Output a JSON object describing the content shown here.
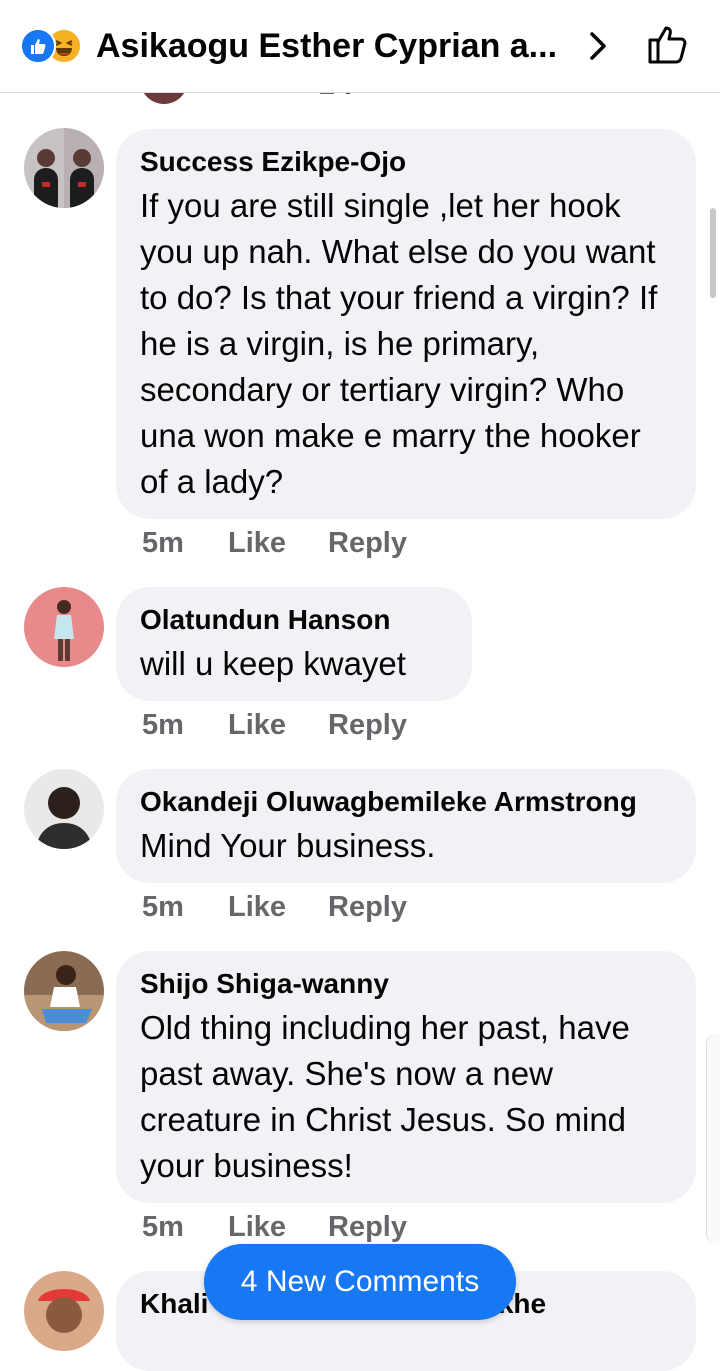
{
  "header": {
    "title": "Asikaogu Esther Cyprian a...",
    "reaction_icons": [
      "like-reaction-icon",
      "haha-reaction-icon"
    ],
    "chevron_icon": "chevron-right-icon",
    "like_icon": "thumbs-up-icon"
  },
  "comments": [
    {
      "name": "Success Ezikpe-Ojo",
      "text": "If you are still single ,let her hook you up nah. What else do you want to do? Is that your friend a virgin? If he is a virgin, is he primary, secondary or tertiary virgin? Who una won make e marry the hooker of a lady?",
      "time": "5m",
      "like": "Like",
      "reply": "Reply"
    },
    {
      "name": "Olatundun Hanson",
      "text": "will u keep kwayet",
      "time": "5m",
      "like": "Like",
      "reply": "Reply"
    },
    {
      "name": "Okandeji Oluwagbemileke Armstrong",
      "text": "Mind Your business.",
      "time": "5m",
      "like": "Like",
      "reply": "Reply"
    },
    {
      "name": "Shijo Shiga-wanny",
      "text": "Old thing including her past, have past away. She's now a new creature in Christ Jesus. So mind your business!",
      "time": "5m",
      "like": "Like",
      "reply": "Reply"
    },
    {
      "name_start": "Khali",
      "name_end": "Otayokhe"
    }
  ],
  "new_comments_label": "4 New Comments",
  "colors": {
    "accent": "#1877f2",
    "bubble": "#f0f2f5",
    "meta_text": "#65676b"
  }
}
